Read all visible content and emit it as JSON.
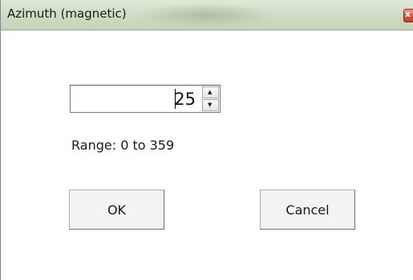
{
  "window": {
    "title": "Azimuth (magnetic)",
    "close_glyph": "x"
  },
  "spinner": {
    "value": "25",
    "up_glyph": "▲",
    "down_glyph": "▼"
  },
  "range_text": "Range: 0 to 359",
  "buttons": {
    "ok_label": "OK",
    "cancel_label": "Cancel"
  },
  "colors": {
    "titlebar": "#cfdcc6",
    "close_button": "#d0553a",
    "background": "#ffffff"
  },
  "icons": {
    "close": "close-icon",
    "spin_up": "spin-up-arrow-icon",
    "spin_down": "spin-down-arrow-icon"
  }
}
